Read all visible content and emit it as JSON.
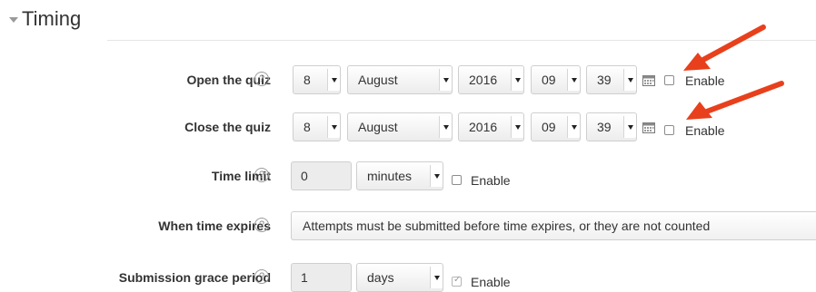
{
  "section": {
    "title": "Timing"
  },
  "help_glyph": "?",
  "open_quiz": {
    "label": "Open the quiz",
    "day": "8",
    "month": "August",
    "year": "2016",
    "hour": "09",
    "minute": "39",
    "enable_label": "Enable",
    "enabled": false
  },
  "close_quiz": {
    "label": "Close the quiz",
    "day": "8",
    "month": "August",
    "year": "2016",
    "hour": "09",
    "minute": "39",
    "enable_label": "Enable",
    "enabled": false
  },
  "time_limit": {
    "label": "Time limit",
    "value": "0",
    "unit": "minutes",
    "enable_label": "Enable",
    "enabled": false
  },
  "when_expires": {
    "label": "When time expires",
    "value": "Attempts must be submitted before time expires, or they are not counted"
  },
  "grace_period": {
    "label": "Submission grace period",
    "value": "1",
    "unit": "days",
    "enable_label": "Enable",
    "enabled": true
  },
  "colors": {
    "annotation_arrow": "#e8401c",
    "accent_text": "#333333"
  },
  "icons": [
    "collapse-triangle-icon",
    "help-icon",
    "calendar-icon",
    "dropdown-arrow-icon"
  ]
}
